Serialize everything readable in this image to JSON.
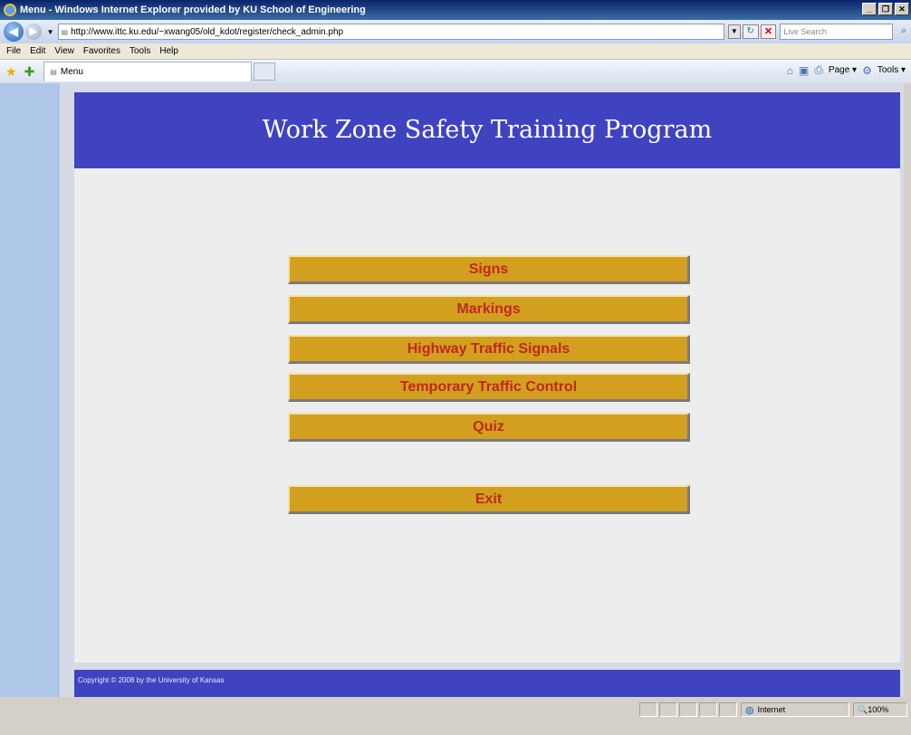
{
  "window": {
    "title": "Menu - Windows Internet Explorer provided by KU School of Engineering",
    "minimize": "_",
    "restore": "❐",
    "close": "✕"
  },
  "address": {
    "url": "http://www.ittc.ku.edu/~xwang05/old_kdot/register/check_admin.php",
    "search_placeholder": "Live Search"
  },
  "menubar": {
    "items": [
      "File",
      "Edit",
      "View",
      "Favorites",
      "Tools",
      "Help"
    ]
  },
  "tabbar": {
    "tab_label": "Menu",
    "page_label": "Page ▾",
    "tools_label": "Tools ▾"
  },
  "page": {
    "title": "Work Zone Safety Training Program",
    "footer": "Copyright © 2008 by the University of Kansas",
    "menu_items": [
      {
        "label": "Signs"
      },
      {
        "label": "Markings"
      },
      {
        "label": "Highway Traffic Signals"
      },
      {
        "label": "Temporary Traffic Control"
      },
      {
        "label": "Quiz"
      }
    ],
    "exit_label": "Exit"
  },
  "status": {
    "text": "",
    "zone": "Internet",
    "zoom": "100%"
  },
  "colors": {
    "header": "#3f43c0",
    "button": "#d2a01e",
    "button_text": "#c0281e",
    "background": "#ededed"
  }
}
